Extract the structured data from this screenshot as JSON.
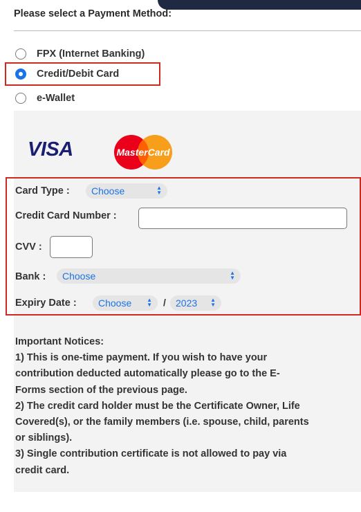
{
  "header": {
    "title": "Please select a Payment Method:"
  },
  "payment_methods": [
    {
      "label": "FPX (Internet Banking)",
      "checked": false
    },
    {
      "label": "Credit/Debit Card",
      "checked": true
    },
    {
      "label": "e-Wallet",
      "checked": false
    }
  ],
  "logos": {
    "visa": "VISA",
    "mastercard": "MasterCard"
  },
  "form": {
    "card_type": {
      "label": "Card Type :",
      "value": "Choose"
    },
    "card_number": {
      "label": "Credit Card Number :",
      "value": ""
    },
    "cvv": {
      "label": "CVV :",
      "value": ""
    },
    "bank": {
      "label": "Bank :",
      "value": "Choose"
    },
    "expiry": {
      "label": "Expiry Date :",
      "month": "Choose",
      "separator": "/",
      "year": "2023"
    }
  },
  "notices": {
    "heading": "Important Notices:",
    "lines": [
      "1) This is one-time payment. If you wish to have your",
      "contribution deducted automatically please go to the E-",
      "Forms section of the previous page.",
      "2) The credit card holder must be the Certificate Owner, Life",
      "Covered(s), or the family members (i.e. spouse, child, parents",
      "or siblings).",
      "3) Single contribution certificate is not allowed to pay via",
      "credit card."
    ]
  },
  "colors": {
    "accent": "#1a73e8",
    "highlight": "#cc2a1f",
    "panel": "#f3f3f3",
    "visa": "#1a1f71",
    "mc_red": "#eb001b",
    "mc_yellow": "#f79e1b"
  }
}
